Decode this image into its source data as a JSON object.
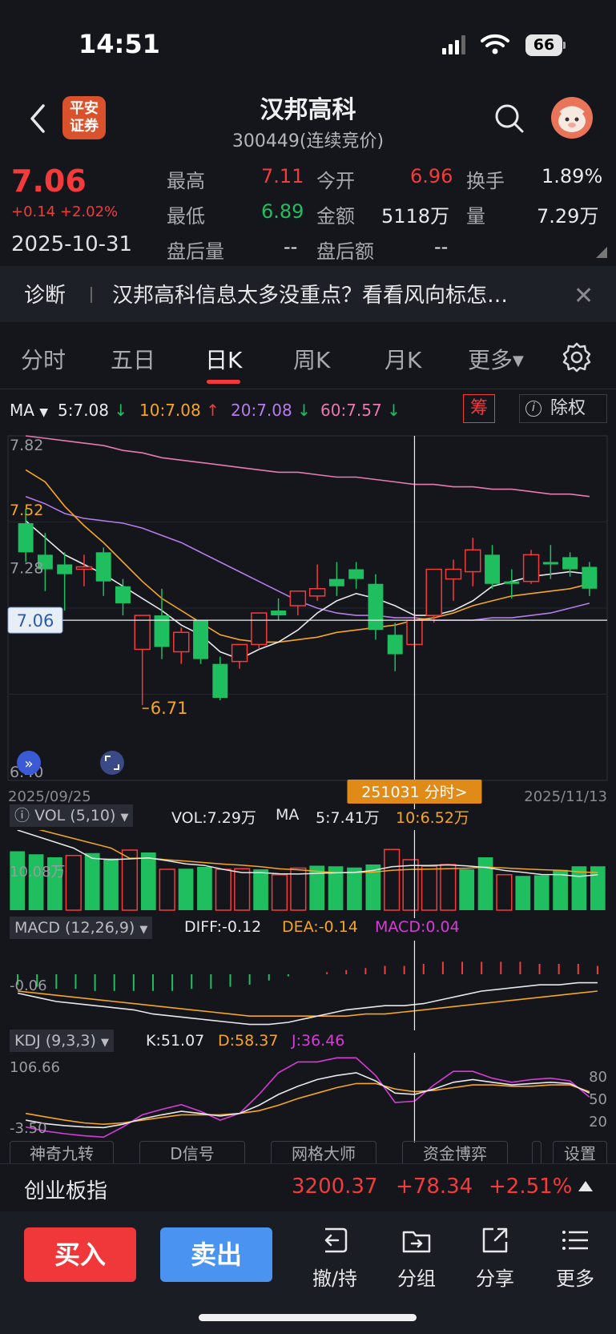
{
  "status_bar": {
    "time": "14:51",
    "battery": "66"
  },
  "header": {
    "broker_logo": "平安证券",
    "broker_logo_line1": "平安",
    "broker_logo_line2": "证券",
    "stock_name": "汉邦高科",
    "stock_code": "300449(连续竞价)"
  },
  "quote": {
    "price": "7.06",
    "change": "+0.14 +2.02%",
    "date": "2025-10-31",
    "high_label": "最高",
    "high": "7.11",
    "open_label": "今开",
    "open": "6.96",
    "turnover_label": "换手",
    "turnover": "1.89%",
    "low_label": "最低",
    "low": "6.89",
    "amount_label": "金额",
    "amount": "5118万",
    "volume_label": "量",
    "volume": "7.29万",
    "after_vol_label": "盘后量",
    "after_vol": "--",
    "after_amt_label": "盘后额",
    "after_amt": "--"
  },
  "notice": {
    "tag": "诊断",
    "text": "汉邦高科信息太多没重点？看看风向标怎…"
  },
  "tabs": [
    {
      "label": "分时"
    },
    {
      "label": "五日"
    },
    {
      "label": "日K"
    },
    {
      "label": "周K"
    },
    {
      "label": "月K"
    },
    {
      "label": "更多"
    }
  ],
  "ma_legend": {
    "label": "MA",
    "ma5": "5:7.08",
    "ma10": "10:7.08",
    "ma20": "20:7.08",
    "ma60": "60:7.57",
    "arrow_down": "↓",
    "arrow_up": "↑",
    "chip_button": "筹",
    "exright_button": "除权"
  },
  "colors": {
    "up": "#f43b3b",
    "down": "#1fbf5f",
    "ma5": "#e8e8ea",
    "ma10": "#f5a623",
    "ma20": "#b57de8",
    "ma60": "#e87ab0"
  },
  "chart_data": {
    "type": "candlestick",
    "x_start": "2025/09/25",
    "x_end": "2025/11/13",
    "y_labels": [
      "7.82",
      "7.52",
      "7.28",
      "6.71",
      "6.40"
    ],
    "current_price_label": "7.06",
    "low_marker": "6.71",
    "crosshair_label": "251031 分时>",
    "ylim": [
      6.4,
      7.82
    ],
    "candles": [
      {
        "o": 7.46,
        "c": 7.34,
        "h": 7.52,
        "l": 7.3
      },
      {
        "o": 7.33,
        "c": 7.27,
        "h": 7.42,
        "l": 7.18
      },
      {
        "o": 7.29,
        "c": 7.25,
        "h": 7.34,
        "l": 7.1
      },
      {
        "o": 7.27,
        "c": 7.28,
        "h": 7.33,
        "l": 7.2
      },
      {
        "o": 7.34,
        "c": 7.22,
        "h": 7.36,
        "l": 7.16
      },
      {
        "o": 7.2,
        "c": 7.13,
        "h": 7.23,
        "l": 7.08
      },
      {
        "o": 6.94,
        "c": 7.08,
        "h": 7.08,
        "l": 6.71
      },
      {
        "o": 7.08,
        "c": 6.95,
        "h": 7.19,
        "l": 6.9
      },
      {
        "o": 6.93,
        "c": 7.01,
        "h": 7.03,
        "l": 6.88
      },
      {
        "o": 7.06,
        "c": 6.9,
        "h": 7.06,
        "l": 6.88
      },
      {
        "o": 6.88,
        "c": 6.74,
        "h": 6.91,
        "l": 6.73
      },
      {
        "o": 6.89,
        "c": 6.96,
        "h": 6.96,
        "l": 6.86
      },
      {
        "o": 6.96,
        "c": 7.09,
        "h": 7.09,
        "l": 6.94
      },
      {
        "o": 7.1,
        "c": 7.08,
        "h": 7.15,
        "l": 7.06
      },
      {
        "o": 7.12,
        "c": 7.18,
        "h": 7.18,
        "l": 7.08
      },
      {
        "o": 7.16,
        "c": 7.19,
        "h": 7.29,
        "l": 7.14
      },
      {
        "o": 7.23,
        "c": 7.2,
        "h": 7.3,
        "l": 7.16
      },
      {
        "o": 7.27,
        "c": 7.23,
        "h": 7.3,
        "l": 7.19
      },
      {
        "o": 7.21,
        "c": 7.02,
        "h": 7.25,
        "l": 6.98
      },
      {
        "o": 7.0,
        "c": 6.92,
        "h": 7.05,
        "l": 6.85
      },
      {
        "o": 6.96,
        "c": 7.06,
        "h": 7.09,
        "l": 6.95
      },
      {
        "o": 7.08,
        "c": 7.27,
        "h": 7.27,
        "l": 7.05
      },
      {
        "o": 7.23,
        "c": 7.27,
        "h": 7.31,
        "l": 7.14
      },
      {
        "o": 7.26,
        "c": 7.35,
        "h": 7.4,
        "l": 7.2
      },
      {
        "o": 7.33,
        "c": 7.21,
        "h": 7.37,
        "l": 7.19
      },
      {
        "o": 7.22,
        "c": 7.21,
        "h": 7.27,
        "l": 7.15
      },
      {
        "o": 7.22,
        "c": 7.33,
        "h": 7.35,
        "l": 7.21
      },
      {
        "o": 7.3,
        "c": 7.29,
        "h": 7.37,
        "l": 7.23
      },
      {
        "o": 7.32,
        "c": 7.27,
        "h": 7.34,
        "l": 7.24
      },
      {
        "o": 7.28,
        "c": 7.19,
        "h": 7.3,
        "l": 7.16
      }
    ],
    "ma5": [
      7.47,
      7.4,
      7.33,
      7.29,
      7.25,
      7.2,
      7.15,
      7.1,
      7.04,
      7.0,
      6.93,
      6.9,
      6.94,
      6.97,
      7.02,
      7.09,
      7.14,
      7.17,
      7.15,
      7.12,
      7.08,
      7.08,
      7.1,
      7.14,
      7.2,
      7.22,
      7.24,
      7.25,
      7.26,
      7.25
    ],
    "ma10": [
      7.68,
      7.63,
      7.53,
      7.45,
      7.38,
      7.3,
      7.22,
      7.15,
      7.1,
      7.05,
      7.0,
      6.98,
      6.97,
      6.97,
      6.98,
      6.99,
      7.01,
      7.02,
      7.03,
      7.04,
      7.06,
      7.07,
      7.09,
      7.12,
      7.14,
      7.16,
      7.17,
      7.18,
      7.19,
      7.21
    ],
    "ma20": [
      7.57,
      7.54,
      7.5,
      7.48,
      7.47,
      7.46,
      7.44,
      7.41,
      7.38,
      7.34,
      7.3,
      7.26,
      7.22,
      7.18,
      7.14,
      7.11,
      7.09,
      7.08,
      7.08,
      7.07,
      7.07,
      7.06,
      7.06,
      7.06,
      7.07,
      7.07,
      7.08,
      7.09,
      7.11,
      7.13
    ],
    "ma60": [
      7.82,
      7.81,
      7.8,
      7.79,
      7.78,
      7.76,
      7.75,
      7.73,
      7.72,
      7.71,
      7.7,
      7.69,
      7.68,
      7.67,
      7.67,
      7.66,
      7.65,
      7.65,
      7.64,
      7.63,
      7.62,
      7.62,
      7.61,
      7.61,
      7.6,
      7.6,
      7.59,
      7.58,
      7.58,
      7.57
    ]
  },
  "vol_panel": {
    "title": "VOL (5,10)",
    "vol": "VOL:7.29万",
    "ma_label": "MA",
    "ma5": "5:7.41万",
    "ma10": "10:6.52万",
    "axis_label": "10.08万",
    "volumes": [
      9.8,
      9.3,
      8.8,
      9.1,
      9.5,
      8.6,
      10.0,
      9.6,
      6.8,
      6.9,
      7.2,
      6.8,
      6.9,
      6.8,
      5.9,
      7.0,
      7.4,
      7.3,
      7.1,
      7.6,
      10.1,
      8.4,
      7.3,
      7.6,
      6.8,
      8.8,
      5.9,
      5.7,
      5.8,
      6.7,
      7.3,
      7.3
    ]
  },
  "macd_panel": {
    "title": "MACD (12,26,9)",
    "diff": "DIFF:-0.12",
    "dea": "DEA:-0.14",
    "macd": "MACD:0.04",
    "axis_label": "-0.06",
    "hist": [
      -0.05,
      -0.06,
      -0.07,
      -0.07,
      -0.08,
      -0.08,
      -0.08,
      -0.08,
      -0.08,
      -0.07,
      -0.07,
      -0.06,
      -0.05,
      -0.03,
      -0.01,
      0.0,
      0.01,
      0.02,
      0.03,
      0.04,
      0.04,
      0.05,
      0.06,
      0.06,
      0.06,
      0.06,
      0.06,
      0.05,
      0.05,
      0.05,
      0.04
    ],
    "diff_line": [
      -0.06,
      -0.08,
      -0.1,
      -0.11,
      -0.12,
      -0.13,
      -0.14,
      -0.16,
      -0.17,
      -0.18,
      -0.19,
      -0.2,
      -0.21,
      -0.21,
      -0.2,
      -0.18,
      -0.16,
      -0.14,
      -0.13,
      -0.12,
      -0.12,
      -0.11,
      -0.09,
      -0.07,
      -0.05,
      -0.04,
      -0.03,
      -0.02,
      -0.02,
      -0.01,
      -0.01
    ],
    "dea_line": [
      -0.05,
      -0.06,
      -0.07,
      -0.08,
      -0.09,
      -0.1,
      -0.11,
      -0.12,
      -0.13,
      -0.14,
      -0.15,
      -0.16,
      -0.17,
      -0.17,
      -0.17,
      -0.17,
      -0.17,
      -0.17,
      -0.16,
      -0.16,
      -0.15,
      -0.14,
      -0.13,
      -0.12,
      -0.11,
      -0.1,
      -0.09,
      -0.08,
      -0.07,
      -0.06,
      -0.05
    ]
  },
  "kdj_panel": {
    "title": "KDJ (9,3,3)",
    "k": "K:51.07",
    "d": "D:58.37",
    "j": "J:36.46",
    "axis_top": "106.66",
    "axis_bottom": "-3.50",
    "right_labels": [
      "80",
      "50",
      "20"
    ],
    "k_line": [
      20,
      15,
      12,
      10,
      9,
      14,
      22,
      28,
      33,
      30,
      26,
      30,
      42,
      58,
      70,
      80,
      86,
      90,
      78,
      60,
      58,
      66,
      76,
      80,
      76,
      72,
      74,
      76,
      74,
      60
    ],
    "d_line": [
      30,
      25,
      20,
      16,
      14,
      16,
      20,
      24,
      28,
      28,
      28,
      30,
      34,
      42,
      52,
      60,
      68,
      74,
      74,
      66,
      62,
      64,
      68,
      72,
      72,
      70,
      70,
      72,
      72,
      62
    ],
    "j_line": [
      10,
      4,
      0,
      -3,
      -5,
      10,
      28,
      36,
      43,
      33,
      20,
      30,
      58,
      90,
      106,
      106,
      112,
      112,
      86,
      46,
      48,
      72,
      92,
      92,
      82,
      76,
      80,
      82,
      78,
      54
    ]
  },
  "tools": [
    "神奇九转",
    "D信号",
    "网格大师",
    "资金博弈",
    "",
    "设置"
  ],
  "index_bar": {
    "name": "创业板指",
    "value": "3200.37",
    "change": "+78.34",
    "pct": "+2.51%"
  },
  "actions": {
    "buy": "买入",
    "sell": "卖出",
    "cancel": "撤/持",
    "group": "分组",
    "share": "分享",
    "more": "更多"
  }
}
